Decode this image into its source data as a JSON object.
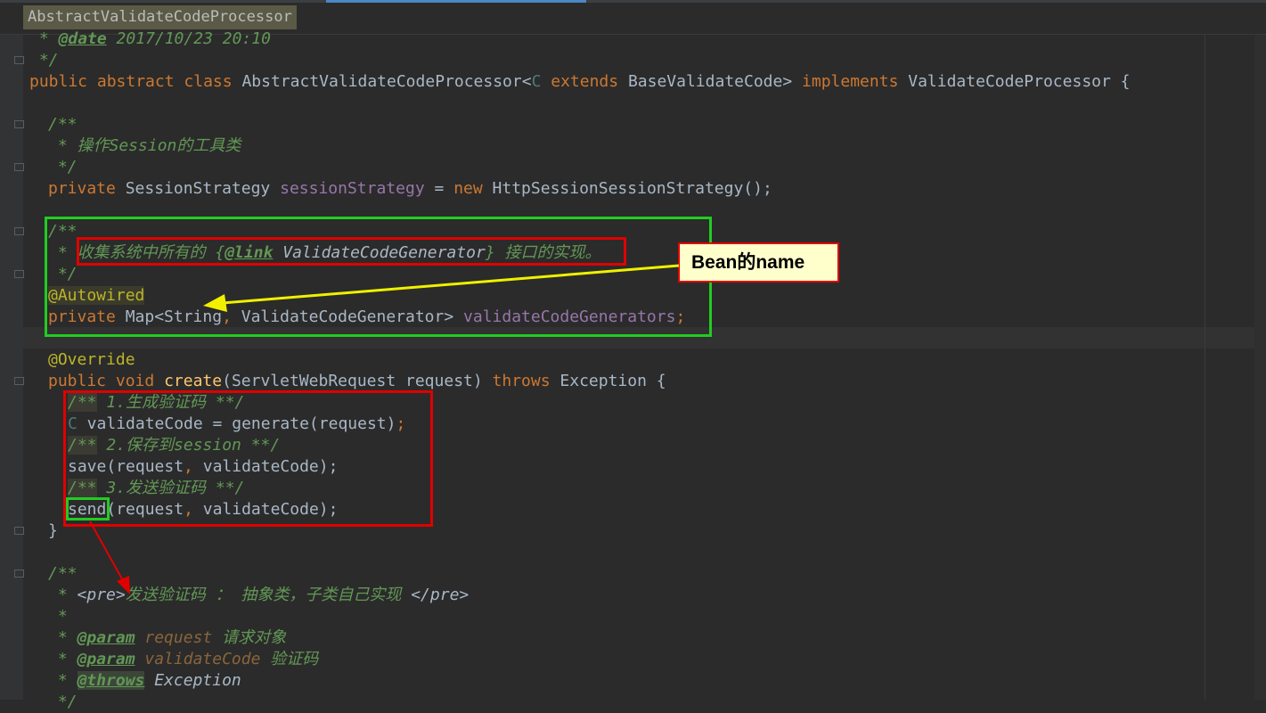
{
  "tab": {
    "title": "AbstractValidateCodeProcessor"
  },
  "code": {
    "l_date_star": " * ",
    "l_date_tag": "@date",
    "l_date_val": " 2017/10/23 20:10",
    "l_close1": " */",
    "class_decl": {
      "public": "public",
      "abstract": "abstract",
      "class": "class",
      "name": "AbstractValidateCodeProcessor<",
      "C": "C",
      "extends": "extends",
      "base": "BaseValidateCode>",
      "implements": "implements",
      "iface": "ValidateCodeProcessor {"
    },
    "doc1_open": "/**",
    "doc1_text": " * 操作Session的工具类",
    "doc1_close": " */",
    "session_field": {
      "private": "private",
      "type": "SessionStrategy",
      "name": "sessionStrategy",
      "eq": " = ",
      "new": "new",
      "ctor": "HttpSessionSessionStrategy();"
    },
    "doc2_open": "/**",
    "doc2_star": " * ",
    "doc2_pre": "收集系统中所有的 {",
    "doc2_link": "@link",
    "doc2_ref": " ValidateCodeGenerator",
    "doc2_post": "} 接口的实现。",
    "doc2_close": " */",
    "autowired": "@Autowired",
    "map_field": {
      "private": "private",
      "type": "Map<String",
      "comma": ",",
      "type2": " ValidateCodeGenerator> ",
      "name": "validateCodeGenerators",
      "semi": ";"
    },
    "override": "@Override",
    "create_decl": {
      "public": "public",
      "void": "void",
      "name": "create",
      "params": "(ServletWebRequest request) ",
      "throws": "throws",
      "exc": " Exception {"
    },
    "c1_open": "/**",
    "c1_text": " 1.生成验证码 **/",
    "gen_C": "C",
    "gen_rest": " validateCode = generate(request)",
    "gen_semi": ";",
    "c2_open": "/**",
    "c2_text": " 2.保存到session **/",
    "save_a": "save(request",
    "save_comma": ",",
    "save_b": " validateCode);",
    "c3_open": "/**",
    "c3_text": " 3.发送验证码 **/",
    "send_name": "send",
    "send_a": "(request",
    "send_comma": ",",
    "send_b": " validateCode);",
    "close_brace": "}",
    "doc3_open": "/**",
    "doc3_star": " * ",
    "doc3_pre": "<pre>",
    "doc3_text": "发送验证码 ： 抽象类，子类自己实现 ",
    "doc3_preclose": "</pre>",
    "doc3_blank": " *",
    "param1_star": " * ",
    "param1_tag": "@param",
    "param1_name": " request",
    "param1_desc": " 请求对象",
    "param2_star": " * ",
    "param2_tag": "@param",
    "param2_name": " validateCode",
    "param2_desc": " 验证码",
    "throws_star": " * ",
    "throws_tag": "@throws",
    "throws_name": " Exception",
    "last_partial": " */"
  },
  "annotation": {
    "callout_text": "Bean的name",
    "green": "#22cc22",
    "red": "#e00000",
    "yellow": "#f0f000"
  }
}
